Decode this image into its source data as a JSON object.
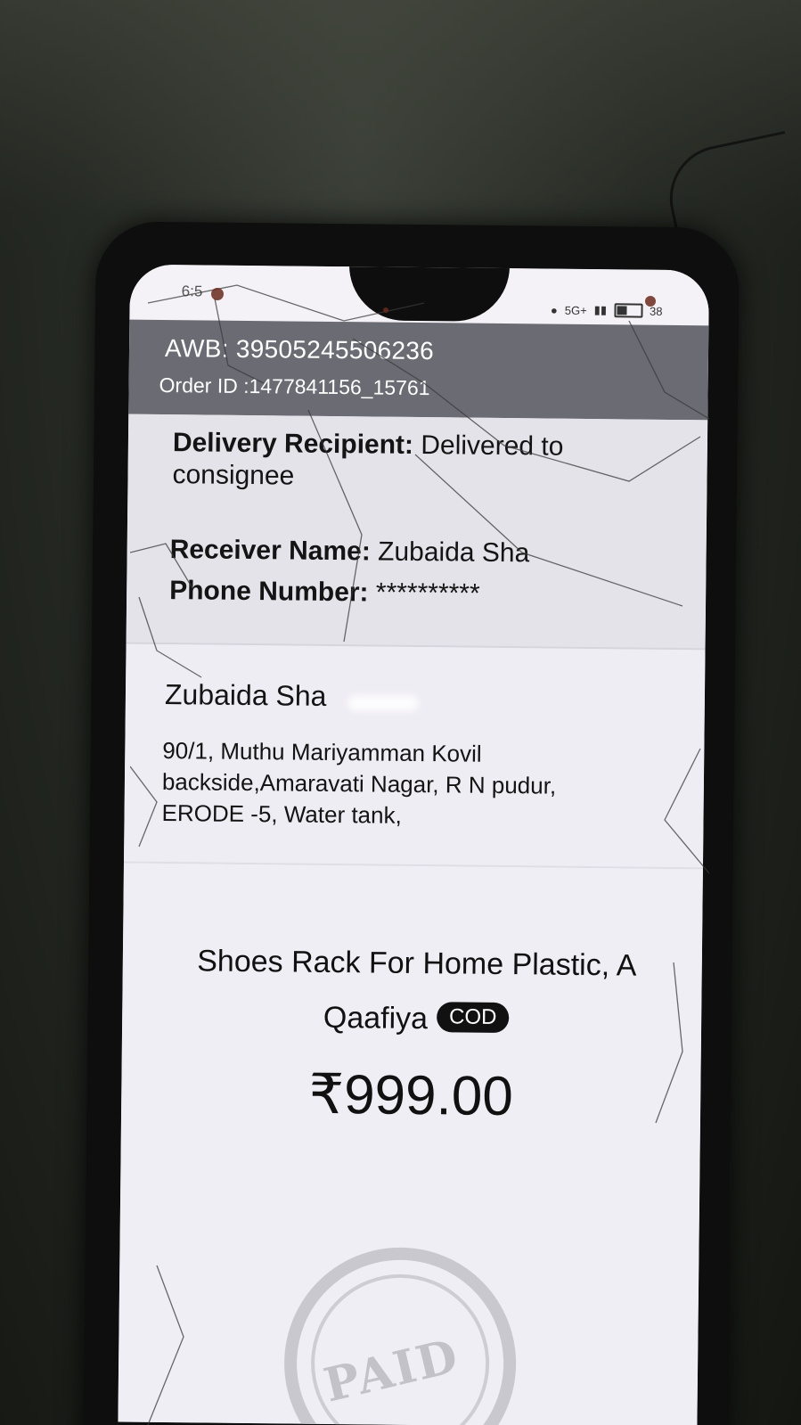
{
  "status_bar": {
    "time": "6:5",
    "network": "5G+",
    "battery": "38"
  },
  "header": {
    "awb": "AWB: 39505245506236",
    "order_id": "Order ID :1477841156_15761"
  },
  "recipient": {
    "delivery_label": "Delivery Recipient:",
    "delivery_value": " Delivered to consignee",
    "receiver_label": "Receiver Name:",
    "receiver_value": " Zubaida Sha",
    "phone_label": "Phone Number:",
    "phone_value": " **********"
  },
  "address": {
    "name": "Zubaida Sha",
    "lines": "90/1, Muthu Mariyamman Kovil backside,Amaravati Nagar, R N pudur, ERODE -5, Water tank,"
  },
  "product": {
    "name": "Shoes Rack For Home Plastic, A Qaafiya",
    "payment_badge": "COD",
    "price": "₹999.00",
    "stamp_text": "PAID"
  },
  "colors": {
    "header_bg": "#6b6b74",
    "recipient_bg": "#e5e3ea",
    "badge_bg": "#111111"
  },
  "icons": {
    "location": "location-pin-icon",
    "signal": "signal-bars-icon",
    "battery": "battery-icon"
  }
}
